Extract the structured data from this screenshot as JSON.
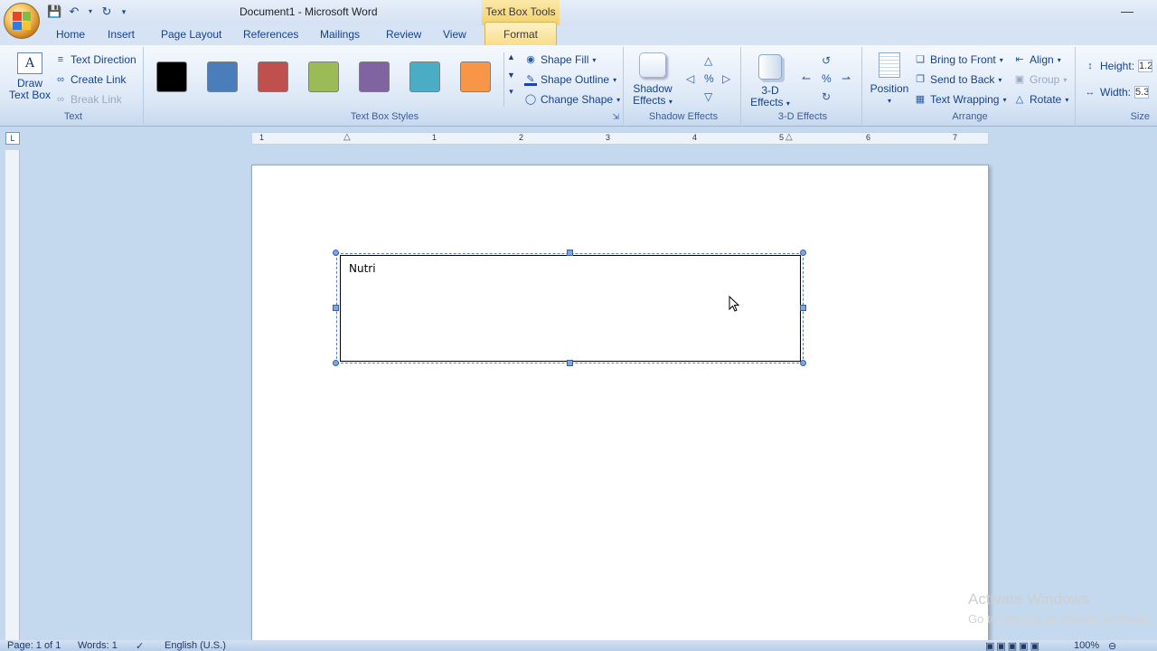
{
  "window": {
    "title": "Document1 - Microsoft Word",
    "context_tab_title": "Text Box Tools"
  },
  "qat": {
    "save_icon": "save-icon",
    "undo_icon": "undo-icon",
    "redo_icon": "redo-icon"
  },
  "tabs": [
    "Home",
    "Insert",
    "Page Layout",
    "References",
    "Mailings",
    "Review",
    "View"
  ],
  "active_tab": "Format",
  "ribbon": {
    "text_group": {
      "label": "Text",
      "draw_text_box_line1": "Draw",
      "draw_text_box_line2": "Text Box",
      "text_direction": "Text Direction",
      "create_link": "Create Link",
      "break_link": "Break Link"
    },
    "styles_group": {
      "label": "Text Box Styles",
      "swatches": [
        "#000000",
        "#4a7ebb",
        "#c0504d",
        "#9bbb59",
        "#8064a2",
        "#4bacc6",
        "#f79646"
      ],
      "shape_fill": "Shape Fill",
      "shape_outline": "Shape Outline",
      "change_shape": "Change Shape"
    },
    "shadow_group": {
      "label": "Shadow Effects",
      "btn_line1": "Shadow",
      "btn_line2": "Effects"
    },
    "threed_group": {
      "label": "3-D Effects",
      "btn_line1": "3-D",
      "btn_line2": "Effects"
    },
    "arrange_group": {
      "label": "Arrange",
      "position": "Position",
      "bring_to_front": "Bring to Front",
      "send_to_back": "Send to Back",
      "text_wrapping": "Text Wrapping",
      "align": "Align",
      "group": "Group",
      "rotate": "Rotate"
    },
    "size_group": {
      "label": "Size",
      "height_label": "Height:",
      "height_value": "1.2",
      "width_label": "Width:",
      "width_value": "5.3"
    }
  },
  "ruler": {
    "numbers": [
      "1",
      "1",
      "2",
      "3",
      "4",
      "5",
      "6",
      "7"
    ],
    "corner": "L"
  },
  "document": {
    "textbox_text": "Nutri"
  },
  "watermark": {
    "line1": "Activate Windows",
    "line2": "Go to Settings to activate Windows."
  },
  "status": {
    "page": "Page: 1 of 1",
    "words": "Words: 1",
    "language": "English (U.S.)",
    "zoom": "100%"
  }
}
